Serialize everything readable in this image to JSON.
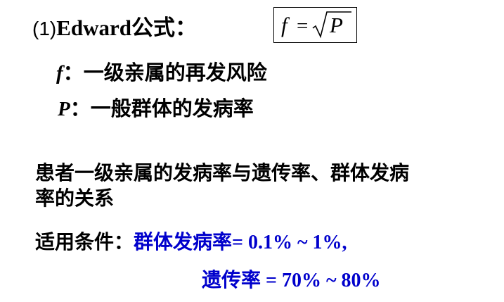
{
  "heading": {
    "number": "(1)",
    "name": "Edward",
    "suffix": "公式："
  },
  "formula": {
    "lhs": "f",
    "equals": "=",
    "rhs": "P"
  },
  "definitions": [
    {
      "symbol": "f",
      "separator": "：",
      "text": "一级亲属的再发风险"
    },
    {
      "symbol": "P",
      "separator": "：",
      "text": "一般群体的发病率"
    }
  ],
  "paragraph": {
    "line1": "患者一级亲属的发病率与遗传率、群体发病",
    "line2": "率的关系"
  },
  "conditions": {
    "label": "适用条件：",
    "item1_label": "群体发病率",
    "item1_value": "= 0.1% ~ 1%,",
    "item2_label": "遗传率",
    "item2_value": " = 70% ~ 80%"
  },
  "colors": {
    "text": "#000000",
    "highlight": "#0000cc"
  }
}
